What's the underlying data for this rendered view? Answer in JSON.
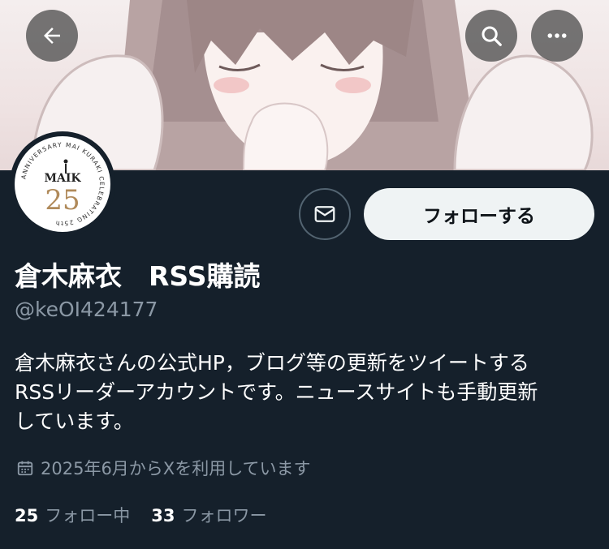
{
  "header": {
    "back_icon": "arrow-left-icon",
    "search_icon": "search-icon",
    "more_icon": "more-horizontal-icon"
  },
  "avatar": {
    "ring_text": "ANNIVERSARY MAI KURAKI CELEBRATING 25th",
    "logo_text": "MAIK",
    "number": "25"
  },
  "actions": {
    "message_icon": "mail-icon",
    "follow_label": "フォローする"
  },
  "profile": {
    "name": "倉木麻衣　RSS購読",
    "handle": "@keOI424177",
    "bio": "倉木麻衣さんの公式HP，ブログ等の更新をツイートする\nRSSリーダーアカウントです。ニュースサイトも手動更新\nしています。",
    "joined": "2025年6月からXを利用しています"
  },
  "stats": {
    "following_count": "25",
    "following_label": "フォロー中",
    "followers_count": "33",
    "followers_label": "フォロワー"
  },
  "colors": {
    "background": "#15202b",
    "secondary_text": "#8b98a5",
    "button_bg": "#eff3f4",
    "avatar_gold": "#b08a5a"
  }
}
